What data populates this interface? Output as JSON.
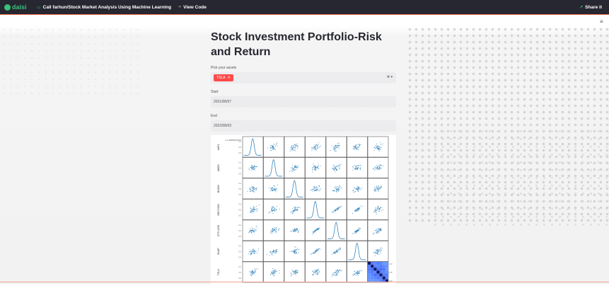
{
  "topbar": {
    "logo_text": "daisi",
    "call_label": "Call farhun/Stock Market Analysis Using Machine Learning",
    "view_code_label": "View Code",
    "share_label": "Share it",
    "brand_color": "#3bbf7a",
    "bar_color": "#262730"
  },
  "main": {
    "title": "Stock Investment Portfolio-Risk and Return",
    "assets_label": "Pick your assets",
    "selected_asset": "TSLA",
    "start_label": "Start",
    "start_value": "2021/08/07",
    "end_label": "End",
    "end_value": "2022/08/03"
  },
  "chart_data": {
    "type": "scatter",
    "kind": "scatter-matrix",
    "variables": [
      "AAPL",
      "AMZN",
      "BNDW",
      "EBIT/USD",
      "ETH-USD",
      "SNAP",
      "TSLA"
    ],
    "top_tick_label": "0.1+988800000000",
    "corr_legend_ticks": [
      "1.0",
      "0.5",
      "0.0"
    ],
    "corr_colors": [
      "#ffffff",
      "#08306b"
    ]
  },
  "colors": {
    "accent": "#ff4b4b",
    "marker": "#1f77b4"
  }
}
